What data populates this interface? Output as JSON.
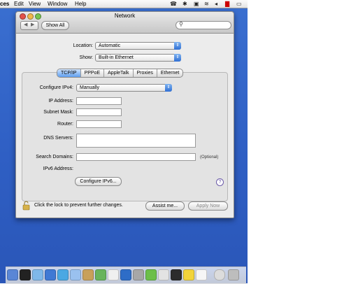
{
  "menubar": {
    "items": [
      "ces",
      "Edit",
      "View",
      "Window",
      "Help"
    ]
  },
  "window": {
    "title": "Network",
    "toolbar": {
      "back": "◀",
      "forward": "▶",
      "show_all_label": "Show All",
      "search_placeholder": ""
    },
    "location": {
      "label": "Location:",
      "value": "Automatic"
    },
    "show": {
      "label": "Show:",
      "value": "Built-in Ethernet"
    },
    "tabs": [
      {
        "label": "TCP/IP",
        "active": true
      },
      {
        "label": "PPPoE",
        "active": false
      },
      {
        "label": "AppleTalk",
        "active": false
      },
      {
        "label": "Proxies",
        "active": false
      },
      {
        "label": "Ethernet",
        "active": false
      }
    ],
    "form": {
      "configure_ipv4": {
        "label": "Configure IPv4:",
        "value": "Manually"
      },
      "ip_address": {
        "label": "IP Address:",
        "value": ""
      },
      "subnet_mask": {
        "label": "Subnet Mask:",
        "value": ""
      },
      "router": {
        "label": "Router:",
        "value": ""
      },
      "dns_servers": {
        "label": "DNS Servers:",
        "value": ""
      },
      "search_domains": {
        "label": "Search Domains:",
        "value": "",
        "optional": "(Optional)"
      },
      "ipv6_address": {
        "label": "IPv6 Address:",
        "value": ""
      },
      "configure_ipv6_label": "Configure IPv6..."
    },
    "footer": {
      "lock_text": "Click the lock to prevent further changes.",
      "assist_label": "Assist me...",
      "apply_label": "Apply Now"
    }
  },
  "icons": {
    "lock": "lock-icon",
    "help": "help-icon",
    "search": "search-icon"
  },
  "dock": {
    "icons": [
      "finder",
      "dashboard",
      "mail",
      "safari",
      "ichat",
      "address-book",
      "itunes",
      "ical",
      "quicktime",
      "system-preferences",
      "network-utility",
      "terminal",
      "textedit",
      "preview",
      "trash"
    ]
  }
}
